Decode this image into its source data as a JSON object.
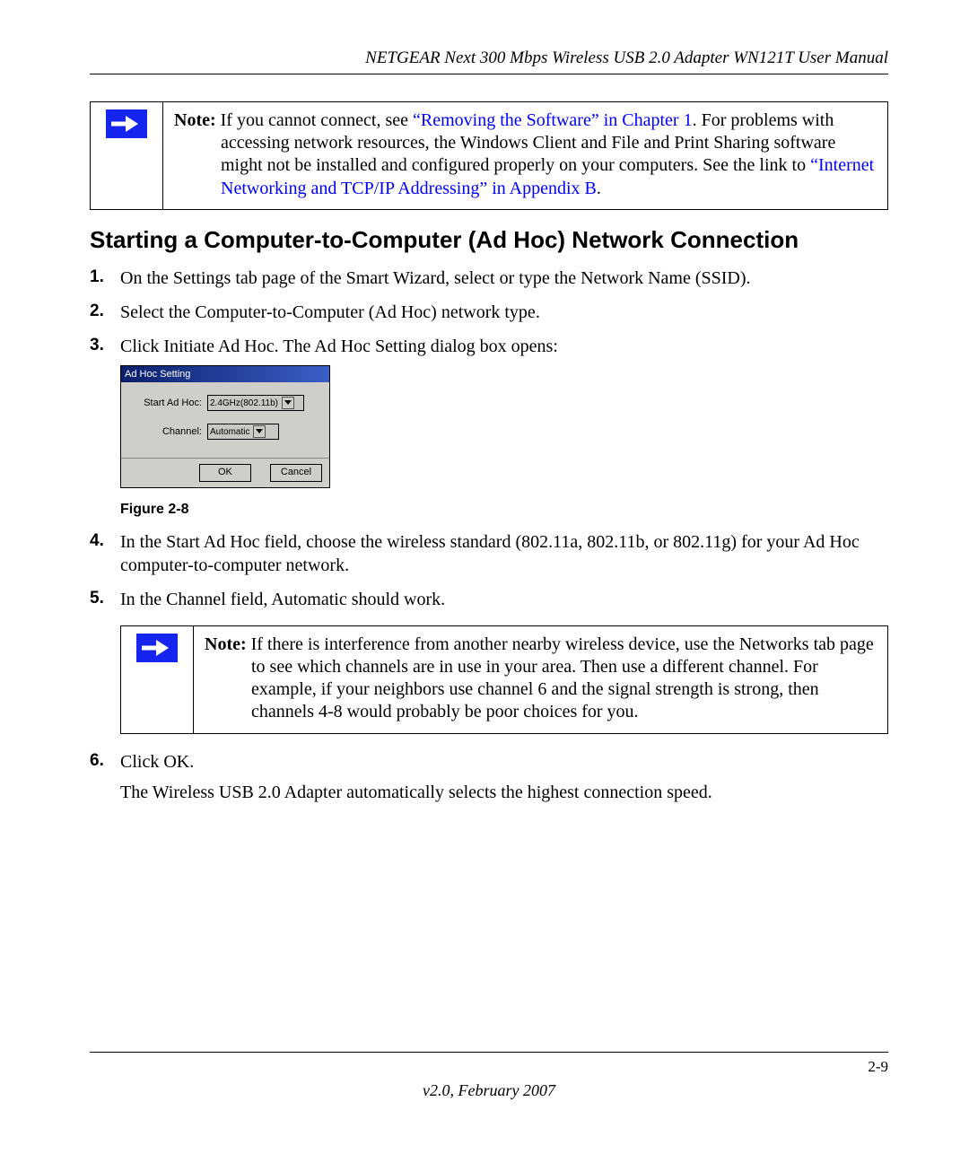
{
  "header": {
    "title": "NETGEAR Next 300 Mbps Wireless USB 2.0 Adapter WN121T User Manual"
  },
  "note1": {
    "label": "Note:",
    "text_before_link1": " If you cannot connect, see ",
    "link1": "“Removing the Software” in Chapter 1",
    "text_mid": ". For problems with accessing network resources, the Windows Client and File and Print Sharing software might not be installed and configured properly on your computers. See the link to ",
    "link2": "“Internet Networking and TCP/IP Addressing” in Appendix B",
    "text_end": "."
  },
  "section_heading": "Starting a Computer-to-Computer (Ad Hoc) Network Connection",
  "steps": {
    "s1_num": "1.",
    "s1": "On the Settings tab page of the Smart Wizard, select or type the Network Name (SSID).",
    "s2_num": "2.",
    "s2": "Select the Computer-to-Computer (Ad Hoc) network type.",
    "s3_num": "3.",
    "s3": "Click Initiate Ad Hoc. The Ad Hoc Setting dialog box opens:",
    "s4_num": "4.",
    "s4": "In the Start Ad Hoc field, choose the wireless standard (802.11a, 802.11b, or 802.11g) for your Ad Hoc computer-to-computer network.",
    "s5_num": "5.",
    "s5": "In the Channel field, Automatic should work.",
    "s6_num": "6.",
    "s6": "Click OK.",
    "s6_sub": "The Wireless USB 2.0 Adapter automatically selects the highest connection speed."
  },
  "dialog": {
    "title": "Ad Hoc Setting",
    "row1_label": "Start Ad Hoc:",
    "row1_value": "2.4GHz(802.11b)",
    "row2_label": "Channel:",
    "row2_value": "Automatic",
    "ok": "OK",
    "cancel": "Cancel"
  },
  "figure_caption": "Figure 2-8",
  "note2": {
    "label": "Note:",
    "text": " If there is interference from another nearby wireless device, use the Networks tab page to see which channels are in use in your area. Then use a different channel. For example, if your neighbors use channel 6 and the signal strength is strong, then channels 4-8 would probably be poor choices for you."
  },
  "footer": {
    "page": "2-9",
    "version": "v2.0, February 2007"
  }
}
